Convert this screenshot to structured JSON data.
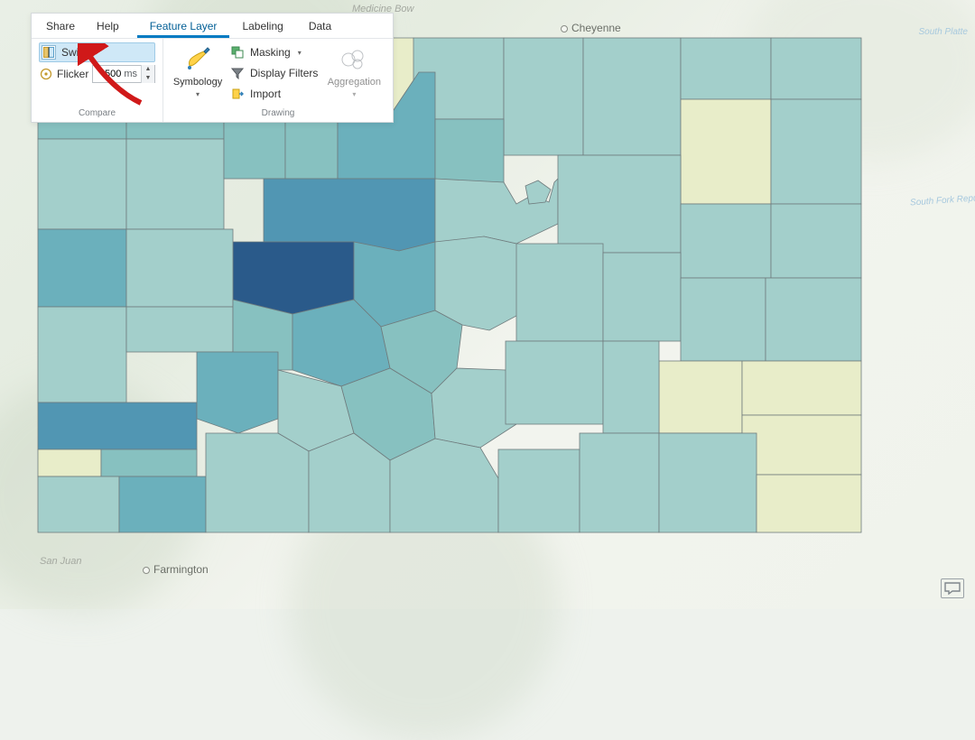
{
  "menu": {
    "share": "Share",
    "help": "Help"
  },
  "tabs": {
    "feature_layer": "Feature Layer",
    "labeling": "Labeling",
    "data": "Data"
  },
  "compare": {
    "group_label": "Compare",
    "swipe_label": "Swipe",
    "flicker_label": "Flicker",
    "flicker_value": "500",
    "flicker_unit": "ms"
  },
  "drawing": {
    "group_label": "Drawing",
    "symbology_label": "Symbology",
    "masking_label": "Masking",
    "display_filters_label": "Display Filters",
    "import_label": "Import",
    "aggregation_label": "Aggregation"
  },
  "basemap": {
    "city_cheyenne": "Cheyenne",
    "city_farmington": "Farmington",
    "label_medicine_bow": "Medicine Bow",
    "label_san_juan": "San Juan",
    "river_south_platte": "South Platte",
    "river_south_fork_republican": "South Fork Republican"
  },
  "colors": {
    "c0": "#e8edc9",
    "c1": "#a3cfcb",
    "c2": "#87c1c0",
    "c3": "#6bb0bc",
    "c4": "#5196b3",
    "c5": "#3c7aa6",
    "c6": "#2a5a8a"
  }
}
